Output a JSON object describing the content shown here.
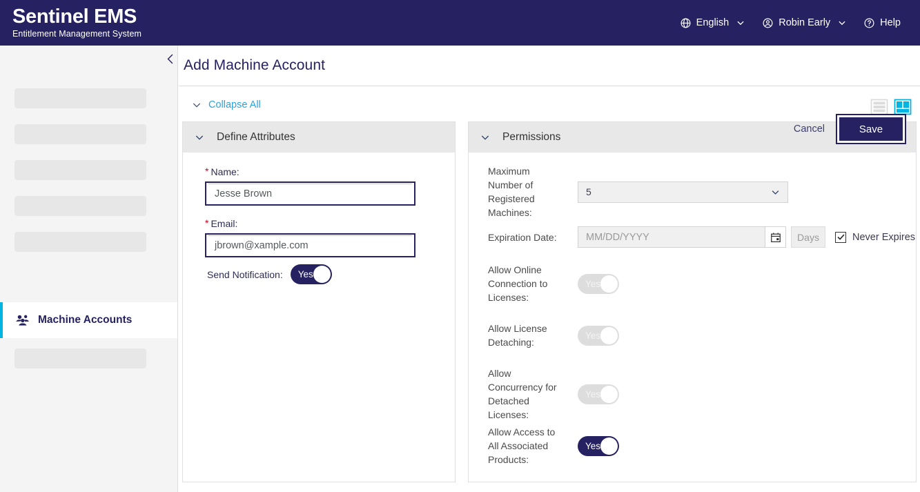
{
  "header": {
    "brand_title": "Sentinel EMS",
    "brand_subtitle": "Entitlement Management System",
    "language": "English",
    "user": "Robin Early",
    "help": "Help"
  },
  "sidebar": {
    "active_item": "Machine Accounts",
    "placeholder_count_top": 5,
    "placeholder_count_bottom": 1
  },
  "page": {
    "title": "Add Machine Account",
    "collapse_all": "Collapse All"
  },
  "panels": {
    "define_attributes": {
      "title": "Define Attributes",
      "name_label": "Name:",
      "name_value": "Jesse Brown",
      "email_label": "Email:",
      "email_value": "jbrown@xample.com",
      "send_notification_label": "Send Notification:",
      "send_notification_value": "Yes"
    },
    "permissions": {
      "title": "Permissions",
      "max_machines_label": "Maximum Number of Registered Machines:",
      "max_machines_value": "5",
      "expiration_label": "Expiration Date:",
      "expiration_placeholder": "MM/DD/YYYY",
      "days_label": "Days",
      "never_expires_label": "Never Expires",
      "never_expires_checked": true,
      "allow_online_label": "Allow Online Connection to Licenses:",
      "allow_online_value": "Yes",
      "allow_detaching_label": "Allow License Detaching:",
      "allow_detaching_value": "Yes",
      "allow_concurrency_label": "Allow Concurrency for Detached Licenses:",
      "allow_concurrency_value": "Yes",
      "allow_access_label": "Allow Access to All Associated Products:",
      "allow_access_value": "Yes"
    }
  },
  "footer": {
    "cancel": "Cancel",
    "save": "Save"
  },
  "colors": {
    "brand_navy": "#262262",
    "accent_cyan": "#00b5e2",
    "link_blue": "#29a3dd",
    "required_red": "#d0021b"
  }
}
